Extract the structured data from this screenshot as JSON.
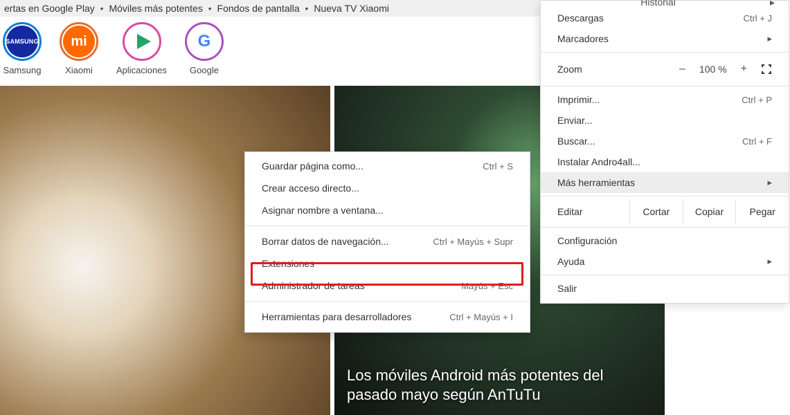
{
  "topbar": {
    "items": [
      "ertas en Google Play",
      "Móviles más potentes",
      "Fondos de pantalla",
      "Nueva TV Xiaomi"
    ]
  },
  "launcher": {
    "items": [
      {
        "label": "Samsung",
        "badge": "SAMSUNG"
      },
      {
        "label": "Xiaomi",
        "badge": "mi"
      },
      {
        "label": "Aplicaciones"
      },
      {
        "label": "Google",
        "badge": "G"
      }
    ]
  },
  "tiles": {
    "right_caption": "Los móviles Android más potentes del pasado mayo según AnTuTu"
  },
  "main_menu": {
    "historial_cut": "Historial",
    "descargas": {
      "label": "Descargas",
      "shortcut": "Ctrl + J"
    },
    "marcadores": {
      "label": "Marcadores"
    },
    "zoom": {
      "label": "Zoom",
      "value": "100 %",
      "minus": "–",
      "plus": "+"
    },
    "imprimir": {
      "label": "Imprimir...",
      "shortcut": "Ctrl + P"
    },
    "enviar": {
      "label": "Enviar..."
    },
    "buscar": {
      "label": "Buscar...",
      "shortcut": "Ctrl + F"
    },
    "instalar": {
      "label": "Instalar Andro4all..."
    },
    "mas": {
      "label": "Más herramientas"
    },
    "editar": {
      "label": "Editar",
      "cortar": "Cortar",
      "copiar": "Copiar",
      "pegar": "Pegar"
    },
    "config": {
      "label": "Configuración"
    },
    "ayuda": {
      "label": "Ayuda"
    },
    "salir": {
      "label": "Salir"
    }
  },
  "submenu": {
    "guardar": {
      "label": "Guardar página como...",
      "shortcut": "Ctrl + S"
    },
    "acceso": {
      "label": "Crear acceso directo..."
    },
    "nombre": {
      "label": "Asignar nombre a ventana..."
    },
    "borrar": {
      "label": "Borrar datos de navegación...",
      "shortcut": "Ctrl + Mayús + Supr"
    },
    "ext": {
      "label": "Extensiones"
    },
    "admin": {
      "label": "Administrador de tareas",
      "shortcut": "Mayús + Esc"
    },
    "dev": {
      "label": "Herramientas para desarrolladores",
      "shortcut": "Ctrl + Mayús + I"
    }
  }
}
